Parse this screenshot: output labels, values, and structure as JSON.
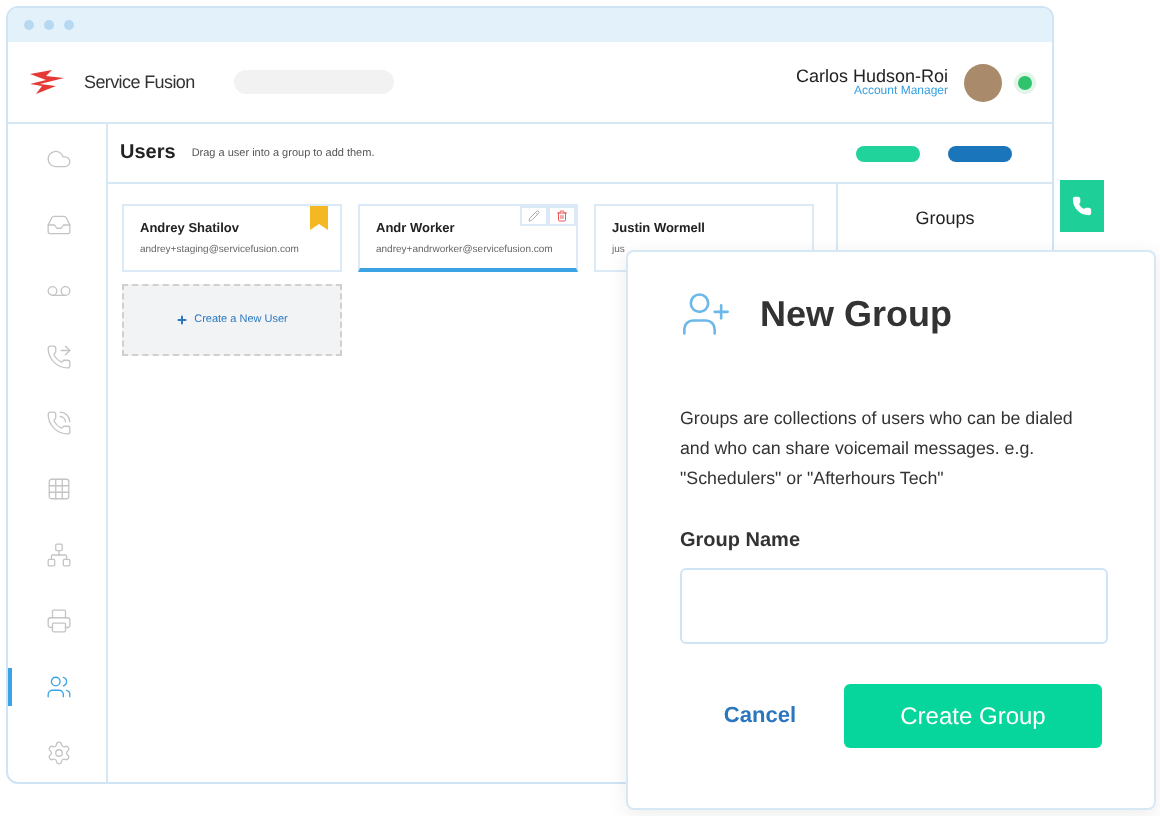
{
  "brand": {
    "name": "Service Fusion"
  },
  "user": {
    "name": "Carlos Hudson-Roi",
    "role": "Account Manager",
    "online": true
  },
  "sidebar": {
    "items": [
      {
        "kind": "cloud",
        "selected": false
      },
      {
        "kind": "inbox",
        "selected": false
      },
      {
        "kind": "voicemail",
        "selected": false
      },
      {
        "kind": "transfer",
        "selected": false
      },
      {
        "kind": "playback",
        "selected": false
      },
      {
        "kind": "keypad",
        "selected": false
      },
      {
        "kind": "tree",
        "selected": false
      },
      {
        "kind": "fax",
        "selected": false
      },
      {
        "kind": "users",
        "selected": true
      },
      {
        "kind": "settings",
        "selected": false
      }
    ]
  },
  "page": {
    "title": "Users",
    "hint": "Drag a user into a group to add them."
  },
  "users": [
    {
      "name": "Andrey Shatilov",
      "email": "andrey+staging@servicefusion.com",
      "bookmarked": true,
      "selected": false
    },
    {
      "name": "Andr Worker",
      "email": "andrey+andrworker@servicefusion.com",
      "bookmarked": false,
      "selected": true
    },
    {
      "name": "Justin Wormell",
      "email": "jus",
      "bookmarked": false,
      "selected": false
    }
  ],
  "create_user": "Create a New User",
  "groups": {
    "title": "Groups"
  },
  "dialog": {
    "title": "New Group",
    "description": "Groups are collections of users who can be dialed and who can share voicemail messages. e.g. \"Schedulers\" or \"Afterhours Tech\"",
    "field_label": "Group Name",
    "cancel": "Cancel",
    "submit": "Create Group"
  }
}
